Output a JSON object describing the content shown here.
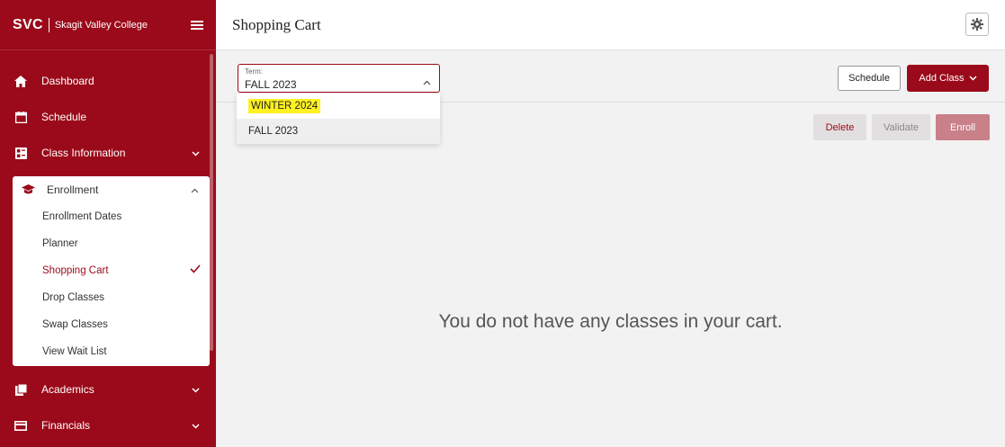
{
  "brand": {
    "short": "SVC",
    "name": "Skagit Valley College"
  },
  "nav": {
    "dashboard": "Dashboard",
    "schedule": "Schedule",
    "class_information": "Class Information",
    "enrollment": {
      "label": "Enrollment",
      "items": [
        {
          "label": "Enrollment Dates"
        },
        {
          "label": "Planner"
        },
        {
          "label": "Shopping Cart"
        },
        {
          "label": "Drop Classes"
        },
        {
          "label": "Swap Classes"
        },
        {
          "label": "View Wait List"
        }
      ]
    },
    "academics": "Academics",
    "financials": "Financials"
  },
  "header": {
    "title": "Shopping Cart"
  },
  "term": {
    "label": "Term:",
    "value": "FALL 2023",
    "options": [
      "WINTER 2024",
      "FALL 2023"
    ]
  },
  "actions": {
    "schedule": "Schedule",
    "add_class": "Add Class",
    "delete": "Delete",
    "validate": "Validate",
    "enroll": "Enroll"
  },
  "empty_message": "You do not have any classes in your cart.",
  "colors": {
    "brand": "#9b0a1a",
    "highlight": "#fff220",
    "enroll_disabled": "#c98088"
  }
}
